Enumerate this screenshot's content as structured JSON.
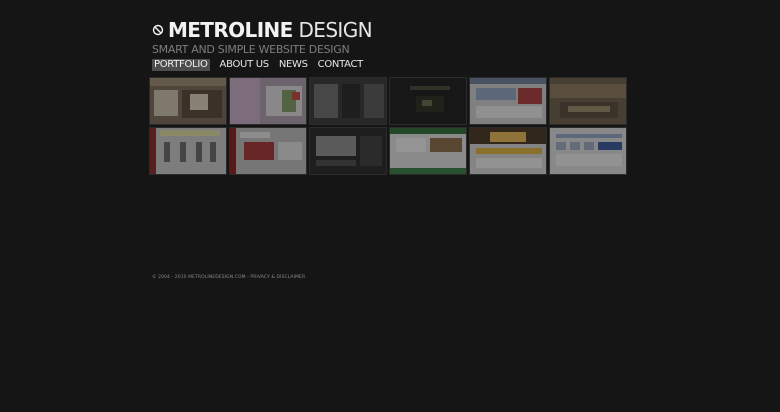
{
  "brand": {
    "name_bold": "METROLINE",
    "name_light": "DESIGN",
    "tagline": "SMART AND SIMPLE WEBSITE DESIGN",
    "logo_icon": "circle-slash-logo-icon"
  },
  "nav": {
    "items": [
      {
        "label": "PORTFOLIO",
        "active": true
      },
      {
        "label": "ABOUT US",
        "active": false
      },
      {
        "label": "NEWS",
        "active": false
      },
      {
        "label": "CONTACT",
        "active": false
      }
    ]
  },
  "portfolio": {
    "thumbnails": [
      {
        "id": 1,
        "bg": "#7a6a58"
      },
      {
        "id": 2,
        "bg": "#a99aaa"
      },
      {
        "id": 3,
        "bg": "#3b3b3b"
      },
      {
        "id": 4,
        "bg": "#1f1f1f"
      },
      {
        "id": 5,
        "bg": "#c9c9c9"
      },
      {
        "id": 6,
        "bg": "#6e604c"
      },
      {
        "id": 7,
        "bg": "#c3c3c3"
      },
      {
        "id": 8,
        "bg": "#b9b9b9"
      },
      {
        "id": 9,
        "bg": "#2b2b2b"
      },
      {
        "id": 10,
        "bg": "#d8d8d8"
      },
      {
        "id": 11,
        "bg": "#cfcfcf"
      },
      {
        "id": 12,
        "bg": "#d6d6d6"
      }
    ]
  },
  "footer": {
    "copyright": "© 2004 - 2010 METROLINEDESIGN.COM",
    "separator": " - ",
    "privacy_link": "PRIVACY & DISCLAIMER"
  },
  "colors": {
    "background": "#151515",
    "text": "#e6e6e6",
    "muted": "#7d7d7d",
    "nav_active_bg": "#4d4d4d"
  }
}
